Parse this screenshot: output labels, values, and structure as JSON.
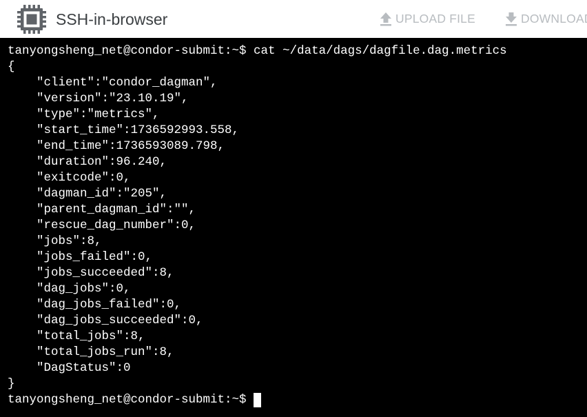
{
  "window": {
    "title": "SSH-in-browser",
    "logo_icon": "chip-icon"
  },
  "toolbar": {
    "upload_label": "UPLOAD FILE",
    "upload_icon": "upload-icon",
    "download_label": "DOWNLOAD FILE",
    "download_icon": "download-icon"
  },
  "colors": {
    "terminal_background": "#000000",
    "terminal_text": "#ffffff",
    "toolbar_background": "#ffffff",
    "toolbar_text_disabled": "#b8bcc0",
    "title_text": "#3c4043",
    "logo": "#5f6368"
  },
  "terminal": {
    "command_line": "tanyongsheng_net@condor-submit:~$ cat ~/data/dags/dagfile.dag.metrics",
    "output_lines": [
      "{",
      "    \"client\":\"condor_dagman\",",
      "    \"version\":\"23.10.19\",",
      "    \"type\":\"metrics\",",
      "    \"start_time\":1736592993.558,",
      "    \"end_time\":1736593089.798,",
      "    \"duration\":96.240,",
      "    \"exitcode\":0,",
      "    \"dagman_id\":\"205\",",
      "    \"parent_dagman_id\":\"\",",
      "    \"rescue_dag_number\":0,",
      "    \"jobs\":8,",
      "    \"jobs_failed\":0,",
      "    \"jobs_succeeded\":8,",
      "    \"dag_jobs\":0,",
      "    \"dag_jobs_failed\":0,",
      "    \"dag_jobs_succeeded\":0,",
      "    \"total_jobs\":8,",
      "    \"total_jobs_run\":8,",
      "    \"DagStatus\":0",
      "}"
    ],
    "prompt": "tanyongsheng_net@condor-submit:~$"
  }
}
